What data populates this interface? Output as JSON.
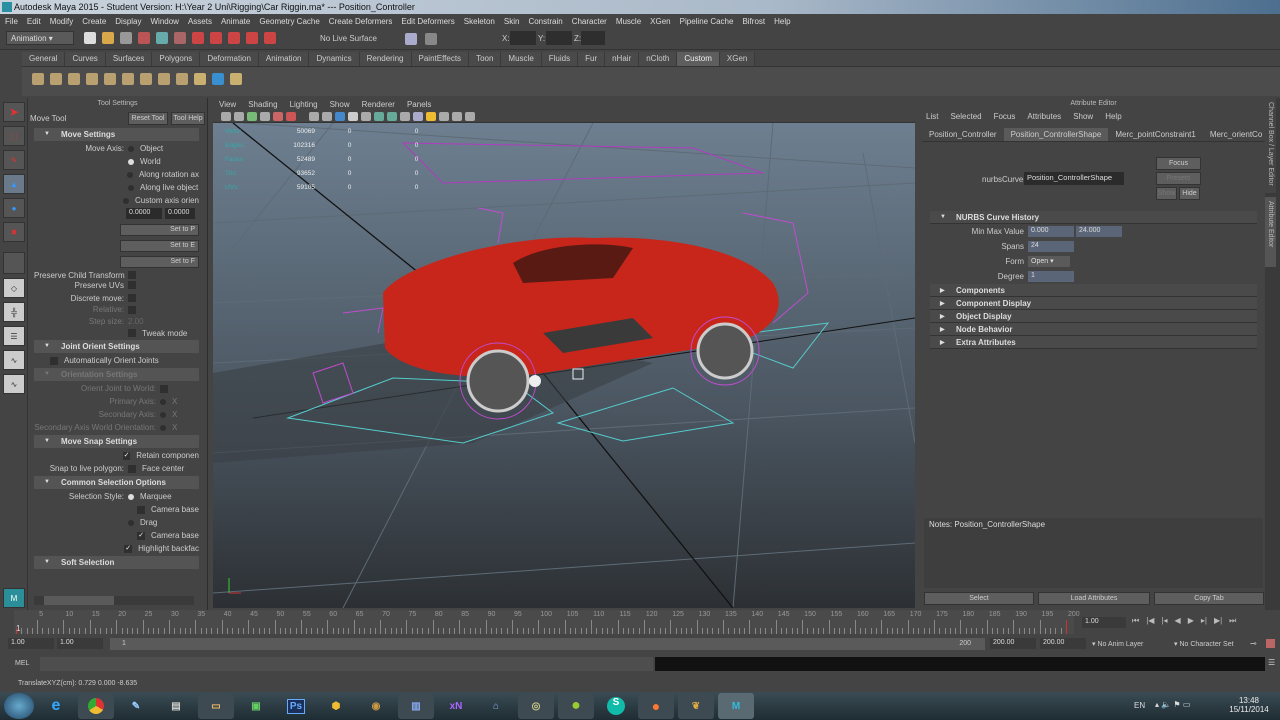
{
  "title": "Autodesk Maya 2015 - Student Version: H:\\Year 2 Uni\\Rigging\\Car Riggin.ma*   ---   Position_Controller",
  "menu": [
    "File",
    "Edit",
    "Modify",
    "Create",
    "Display",
    "Window",
    "Assets",
    "Animate",
    "Geometry Cache",
    "Create Deformers",
    "Edit Deformers",
    "Skeleton",
    "Skin",
    "Constrain",
    "Character",
    "Muscle",
    "XGen",
    "Pipeline Cache",
    "Bifrost",
    "Help"
  ],
  "status": {
    "menuset": "Animation",
    "live_surface": "No Live Surface",
    "x_label": "X:",
    "y_label": "Y:",
    "z_label": "Z:"
  },
  "shelf_tabs": [
    "General",
    "Curves",
    "Surfaces",
    "Polygons",
    "Deformation",
    "Animation",
    "Dynamics",
    "Rendering",
    "PaintEffects",
    "Toon",
    "Muscle",
    "Fluids",
    "Fur",
    "nHair",
    "nCloth",
    "Custom",
    "XGen"
  ],
  "shelf_active": "Custom",
  "tool_settings": {
    "panel_title": "Tool Settings",
    "tool_name": "Move Tool",
    "reset": "Reset Tool",
    "help": "Tool Help",
    "move_settings": "Move Settings",
    "move_axis": "Move Axis:",
    "axis_options": [
      "Object",
      "World",
      "Along rotation ax",
      "Along live object",
      "Custom axis orien"
    ],
    "custom_vals": [
      "0.0000",
      "0.0000"
    ],
    "set_buttons": [
      "Set to P",
      "Set to E",
      "Set to F"
    ],
    "preserve_child": "Preserve Child Transform",
    "preserve_uvs": "Preserve UVs",
    "discrete": "Discrete move:",
    "relative": "Relative:",
    "step_size": "Step size:",
    "step_val": "2.00",
    "tweak": "Tweak mode",
    "joint_orient": "Joint Orient Settings",
    "auto_orient": "Automatically Orient Joints",
    "orientation": "Orientation Settings",
    "orient_world": "Orient Joint to World:",
    "primary": "Primary Axis:",
    "secondary": "Secondary Axis:",
    "sec_world": "Secondary Axis World Orientation:",
    "x": "X",
    "snap": "Move Snap Settings",
    "retain": "Retain componen",
    "snap_live": "Snap to live polygon:",
    "face_center": "Face center",
    "common": "Common Selection Options",
    "sel_style": "Selection Style:",
    "marquee": "Marquee",
    "camera_based": "Camera base",
    "drag": "Drag",
    "camera_based2": "Camera base",
    "highlight": "Highlight backfac",
    "soft": "Soft Selection"
  },
  "viewport": {
    "menu": [
      "View",
      "Shading",
      "Lighting",
      "Show",
      "Renderer",
      "Panels"
    ],
    "hud": [
      {
        "k": "Verts:",
        "v": "50069",
        "a": "0",
        "b": "0"
      },
      {
        "k": "Edges:",
        "v": "102316",
        "a": "0",
        "b": "0"
      },
      {
        "k": "Faces:",
        "v": "52489",
        "a": "0",
        "b": "0"
      },
      {
        "k": "Tris:",
        "v": "93652",
        "a": "0",
        "b": "0"
      },
      {
        "k": "UVs:",
        "v": "59105",
        "a": "0",
        "b": "0"
      }
    ],
    "car_color": "#c8261a"
  },
  "attr": {
    "title": "Attribute Editor",
    "menu": [
      "List",
      "Selected",
      "Focus",
      "Attributes",
      "Show",
      "Help"
    ],
    "tabs": [
      "Position_Controller",
      "Position_ControllerShape",
      "Merc_pointConstraint1",
      "Merc_orientCo"
    ],
    "node_label": "nurbsCurve:",
    "node_value": "Position_ControllerShape",
    "focus": "Focus",
    "presets": "Presets",
    "show": "Show",
    "hide": "Hide",
    "history": "NURBS Curve History",
    "minmax": "Min Max Value",
    "min": "0.000",
    "max": "24.000",
    "spans_l": "Spans",
    "spans": "24",
    "form_l": "Form",
    "form": "Open",
    "degree_l": "Degree",
    "degree": "1",
    "sections": [
      "Components",
      "Component Display",
      "Object Display",
      "Node Behavior",
      "Extra Attributes"
    ],
    "notes": "Notes:  Position_ControllerShape",
    "select": "Select",
    "load": "Load Attributes",
    "copy": "Copy Tab"
  },
  "side_tabs": [
    "Channel Box / Layer Editor",
    "Attribute Editor"
  ],
  "time": {
    "ticks": [
      "5",
      "10",
      "15",
      "20",
      "25",
      "30",
      "35",
      "40",
      "45",
      "50",
      "55",
      "60",
      "65",
      "70",
      "75",
      "80",
      "85",
      "90",
      "95",
      "100",
      "105",
      "110",
      "115",
      "120",
      "125",
      "130",
      "135",
      "140",
      "145",
      "150",
      "155",
      "160",
      "165",
      "170",
      "175",
      "180",
      "185",
      "190",
      "195",
      "200"
    ],
    "current_marker": "1",
    "current": "1.00",
    "start": "1.00",
    "start2": "1.00",
    "range_start": "1",
    "range_end": "200",
    "end": "200.00",
    "end2": "200.00",
    "anim_layer": "No Anim Layer",
    "char_set": "No Character Set"
  },
  "cmd": {
    "label": "MEL"
  },
  "help": "TranslateXYZ(cm):   0.729     0.000     -8.635",
  "taskbar": {
    "lang": "EN",
    "time": "13:48",
    "date": "15/11/2014",
    "ps": "Ps",
    "xn": "xN"
  }
}
